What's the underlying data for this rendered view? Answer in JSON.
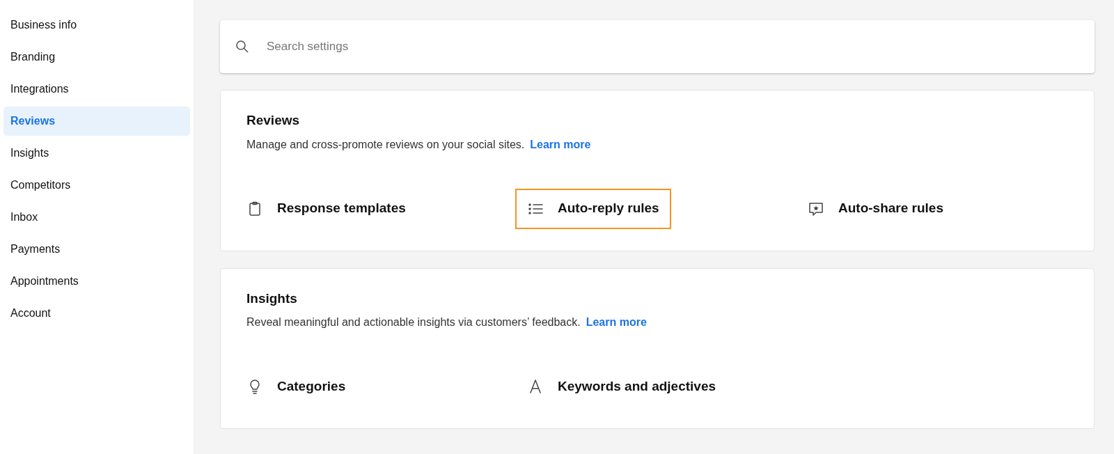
{
  "sidebar": {
    "items": [
      {
        "label": "Business info",
        "selected": false
      },
      {
        "label": "Branding",
        "selected": false
      },
      {
        "label": "Integrations",
        "selected": false
      },
      {
        "label": "Reviews",
        "selected": true
      },
      {
        "label": "Insights",
        "selected": false
      },
      {
        "label": "Competitors",
        "selected": false
      },
      {
        "label": "Inbox",
        "selected": false
      },
      {
        "label": "Payments",
        "selected": false
      },
      {
        "label": "Appointments",
        "selected": false
      },
      {
        "label": "Account",
        "selected": false
      }
    ]
  },
  "search": {
    "placeholder": "Search settings"
  },
  "sections": [
    {
      "title": "Reviews",
      "description": "Manage and cross-promote reviews on your social sites.",
      "link": "Learn more",
      "items": [
        {
          "label": "Response templates",
          "highlighted": false
        },
        {
          "label": "Auto-reply rules",
          "highlighted": true
        },
        {
          "label": "Auto-share rules",
          "highlighted": false
        }
      ]
    },
    {
      "title": "Insights",
      "description": "Reveal meaningful and actionable insights via customers’ feedback.",
      "link": "Learn more",
      "items": [
        {
          "label": "Categories",
          "highlighted": false
        },
        {
          "label": "Keywords and adjectives",
          "highlighted": false
        }
      ]
    }
  ]
}
